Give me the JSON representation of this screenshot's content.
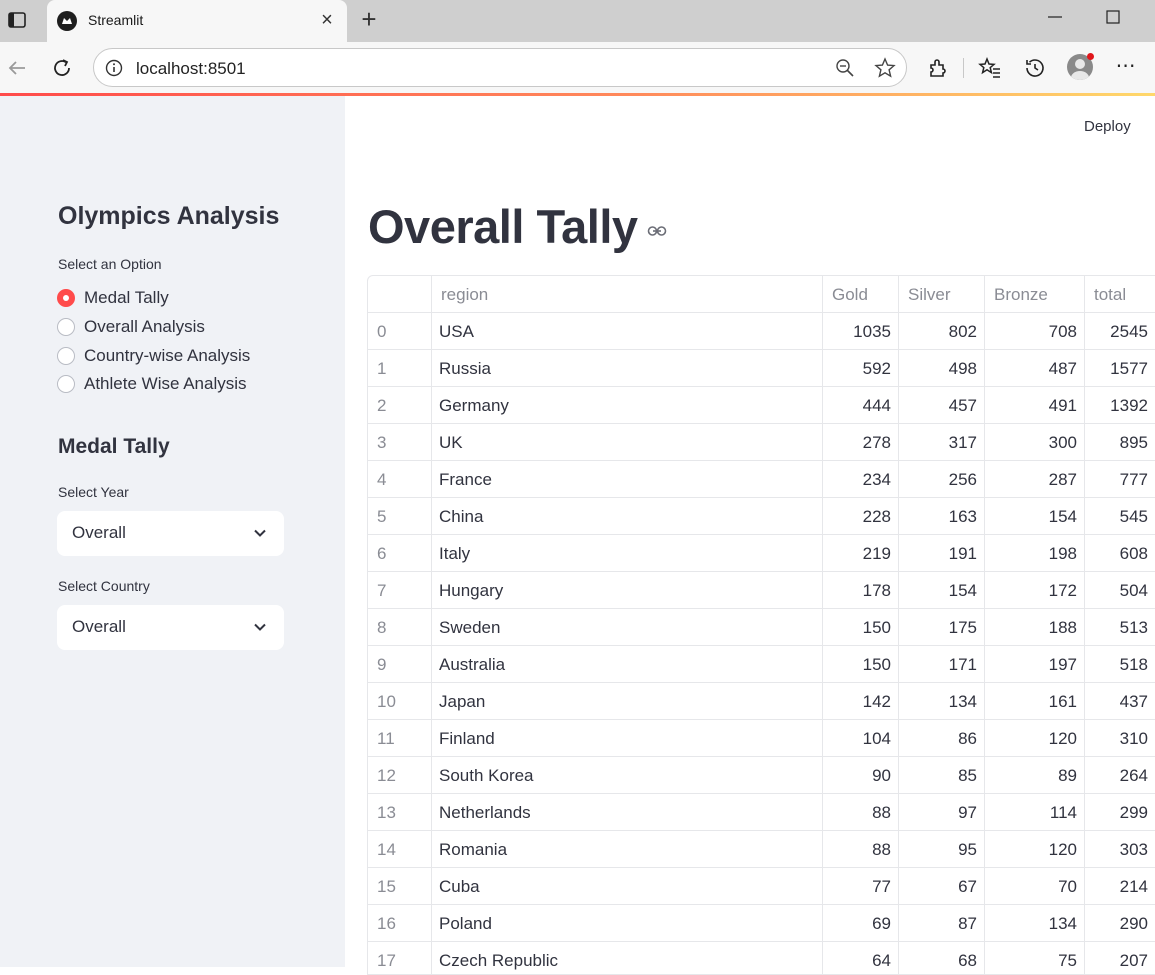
{
  "browser": {
    "tab_title": "Streamlit",
    "url": "localhost:8501"
  },
  "header": {
    "deploy_label": "Deploy"
  },
  "sidebar": {
    "title": "Olympics Analysis",
    "option_label": "Select an Option",
    "options": [
      {
        "label": "Medal Tally",
        "selected": true
      },
      {
        "label": "Overall Analysis",
        "selected": false
      },
      {
        "label": "Country-wise Analysis",
        "selected": false
      },
      {
        "label": "Athlete Wise Analysis",
        "selected": false
      }
    ],
    "section_title": "Medal Tally",
    "year_label": "Select Year",
    "year_value": "Overall",
    "country_label": "Select Country",
    "country_value": "Overall"
  },
  "main": {
    "title": "Overall Tally",
    "table": {
      "columns": [
        "",
        "region",
        "Gold",
        "Silver",
        "Bronze",
        "total"
      ],
      "rows": [
        [
          "0",
          "USA",
          "1035",
          "802",
          "708",
          "2545"
        ],
        [
          "1",
          "Russia",
          "592",
          "498",
          "487",
          "1577"
        ],
        [
          "2",
          "Germany",
          "444",
          "457",
          "491",
          "1392"
        ],
        [
          "3",
          "UK",
          "278",
          "317",
          "300",
          "895"
        ],
        [
          "4",
          "France",
          "234",
          "256",
          "287",
          "777"
        ],
        [
          "5",
          "China",
          "228",
          "163",
          "154",
          "545"
        ],
        [
          "6",
          "Italy",
          "219",
          "191",
          "198",
          "608"
        ],
        [
          "7",
          "Hungary",
          "178",
          "154",
          "172",
          "504"
        ],
        [
          "8",
          "Sweden",
          "150",
          "175",
          "188",
          "513"
        ],
        [
          "9",
          "Australia",
          "150",
          "171",
          "197",
          "518"
        ],
        [
          "10",
          "Japan",
          "142",
          "134",
          "161",
          "437"
        ],
        [
          "11",
          "Finland",
          "104",
          "86",
          "120",
          "310"
        ],
        [
          "12",
          "South Korea",
          "90",
          "85",
          "89",
          "264"
        ],
        [
          "13",
          "Netherlands",
          "88",
          "97",
          "114",
          "299"
        ],
        [
          "14",
          "Romania",
          "88",
          "95",
          "120",
          "303"
        ],
        [
          "15",
          "Cuba",
          "77",
          "67",
          "70",
          "214"
        ],
        [
          "16",
          "Poland",
          "69",
          "87",
          "134",
          "290"
        ],
        [
          "17",
          "Czech Republic",
          "64",
          "68",
          "75",
          "207"
        ]
      ]
    }
  }
}
